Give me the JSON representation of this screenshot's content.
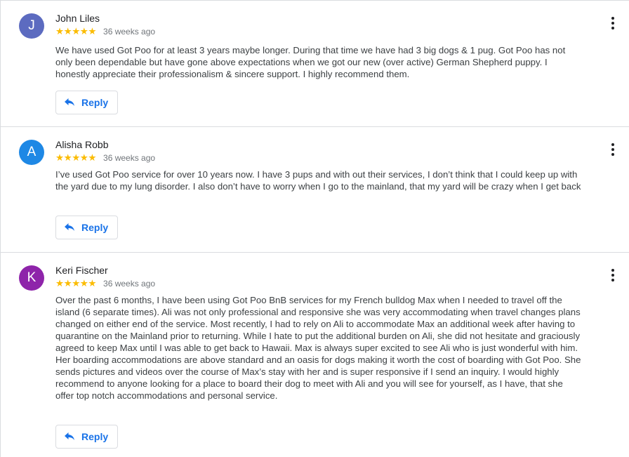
{
  "reviews": [
    {
      "initial": "J",
      "avatar_color": "#5c6bc0",
      "name": "John Liles",
      "stars": "★★★★★",
      "ago": "36 weeks ago",
      "text": "We have used Got Poo for at least 3 years maybe longer. During that time we have had 3 big dogs & 1 pug. Got Poo has not only been dependable but have gone above expectations when we got our new (over active) German Shepherd puppy. I honestly appreciate their professionalism & sincere support. I highly recommend them.",
      "reply_label": "Reply"
    },
    {
      "initial": "A",
      "avatar_color": "#1e88e5",
      "name": "Alisha Robb",
      "stars": "★★★★★",
      "ago": "36 weeks ago",
      "text": "I’ve used Got Poo service for over 10 years now. I have 3 pups and with out their services, I don’t think that I could keep up with the yard due to my lung disorder. I also don’t have to worry when I go to the mainland, that my yard will be crazy when I get back",
      "reply_label": "Reply"
    },
    {
      "initial": "K",
      "avatar_color": "#8e24aa",
      "name": "Keri Fischer",
      "stars": "★★★★★",
      "ago": "36 weeks ago",
      "text": "Over the past 6 months, I have been using Got Poo BnB services for my French bulldog Max when I needed to travel off the island (6 separate times). Ali was not only professional and responsive she was very accommodating when travel changes plans changed on either end of the service. Most recently, I had to rely on Ali to accommodate Max an additional week after having to quarantine on the Mainland prior to returning. While I hate to put the additional burden on Ali, she did not hesitate and graciously agreed to keep Max until I was able to get back to Hawaii. Max is always super excited to see Ali who is just wonderful with him. Her boarding accommodations are above standard and an oasis for dogs making it worth the cost of boarding with Got Poo. She sends pictures and videos over the course of Max’s stay with her and is super responsive if I send an inquiry. I would highly recommend to anyone looking for a place to board their dog to meet with Ali and you will see for yourself, as I have, that she offer top notch accommodations and personal service.",
      "reply_label": "Reply"
    }
  ]
}
